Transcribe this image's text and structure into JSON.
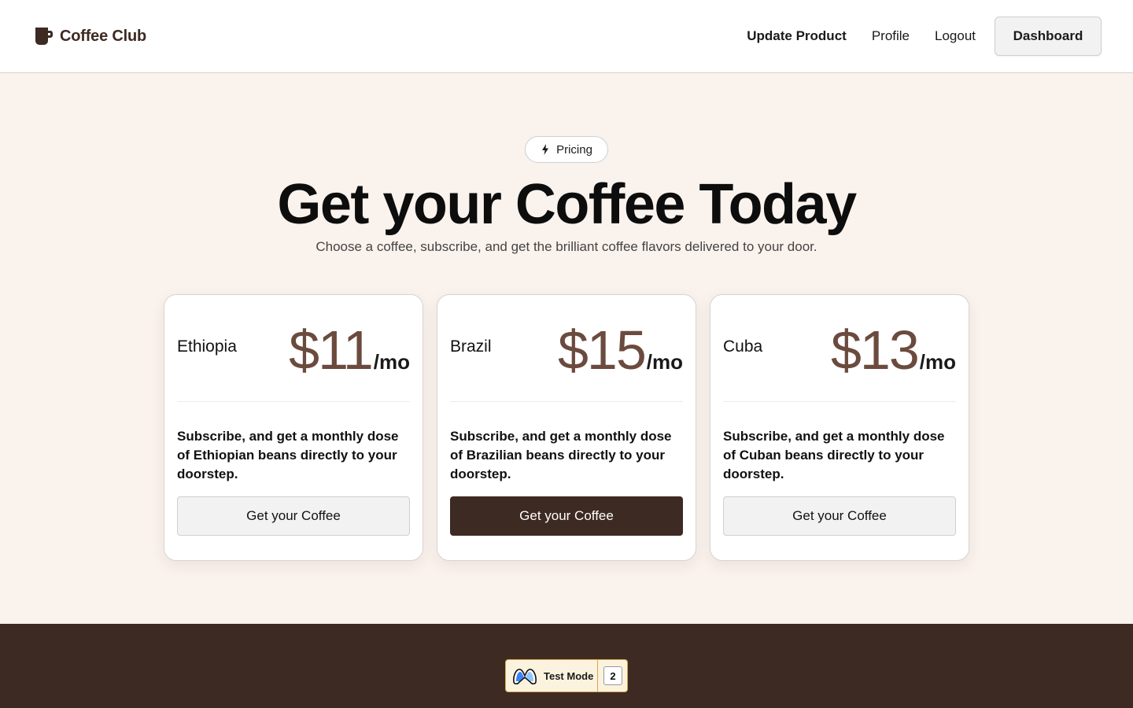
{
  "brand": {
    "name": "Coffee Club",
    "icon": "coffee-cup-icon"
  },
  "nav": {
    "items": [
      {
        "label": "Update Product"
      },
      {
        "label": "Profile"
      },
      {
        "label": "Logout"
      }
    ],
    "dashboard_label": "Dashboard"
  },
  "hero": {
    "badge_label": "Pricing",
    "badge_icon": "lightning-icon",
    "title": "Get your Coffee Today",
    "subtitle": "Choose a coffee, subscribe, and get the brilliant coffee flavors delivered to your door."
  },
  "plans": [
    {
      "country": "Ethiopia",
      "price": "$11",
      "period": "/mo",
      "description": "Subscribe, and get a monthly dose of Ethiopian beans directly to your doorstep.",
      "cta": "Get your Coffee"
    },
    {
      "country": "Brazil",
      "price": "$15",
      "period": "/mo",
      "description": "Subscribe, and get a monthly dose of Brazilian beans directly to your doorstep.",
      "cta": "Get your Coffee"
    },
    {
      "country": "Cuba",
      "price": "$13",
      "period": "/mo",
      "description": "Subscribe, and get a monthly dose of Cuban beans directly to your doorstep.",
      "cta": "Get your Coffee"
    }
  ],
  "footer": {
    "test_mode_label": "Test Mode",
    "test_mode_count": "2",
    "test_mode_icon": "memberstack-logo-icon"
  },
  "colors": {
    "page_background": "#faf2ed",
    "brand_brown": "#3d2a22",
    "price_brown": "#6b4b3e",
    "test_mode_bg": "#fbf3dd"
  }
}
